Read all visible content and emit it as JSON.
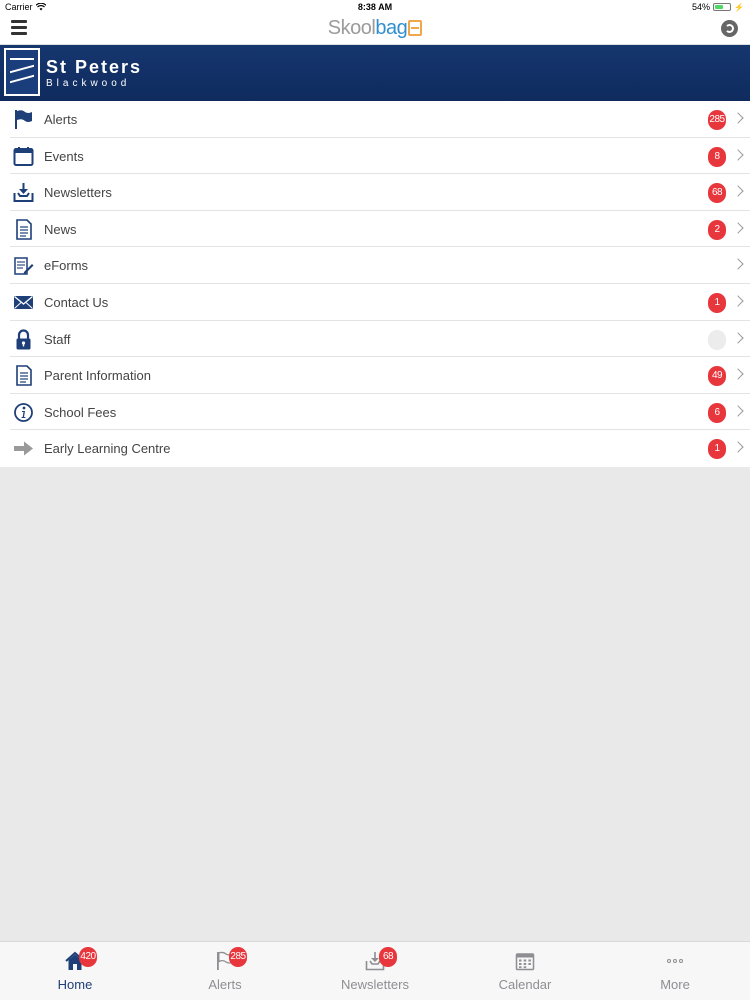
{
  "status_bar": {
    "carrier": "Carrier",
    "time": "8:38 AM",
    "battery": "54%",
    "battery_level": 0.54
  },
  "nav": {
    "logo_part1": "Skool",
    "logo_part2": "bag"
  },
  "school": {
    "name": "St Peters",
    "subtitle": "Blackwood"
  },
  "menu": [
    {
      "label": "Alerts",
      "badge": "285",
      "icon": "flag-icon"
    },
    {
      "label": "Events",
      "badge": "8",
      "icon": "calendar-icon"
    },
    {
      "label": "Newsletters",
      "badge": "68",
      "icon": "inbox-download-icon"
    },
    {
      "label": "News",
      "badge": "2",
      "icon": "document-icon"
    },
    {
      "label": "eForms",
      "badge": "",
      "icon": "form-pencil-icon"
    },
    {
      "label": "Contact Us",
      "badge": "1",
      "icon": "envelope-icon"
    },
    {
      "label": "Staff",
      "badge": "",
      "icon": "lock-icon"
    },
    {
      "label": "Parent Information",
      "badge": "49",
      "icon": "document-icon"
    },
    {
      "label": "School Fees",
      "badge": "6",
      "icon": "info-icon"
    },
    {
      "label": "Early Learning Centre",
      "badge": "1",
      "icon": "arrow-right-icon"
    }
  ],
  "tabs": [
    {
      "label": "Home",
      "badge": "420",
      "icon": "home-icon",
      "active": true
    },
    {
      "label": "Alerts",
      "badge": "285",
      "icon": "flag-icon"
    },
    {
      "label": "Newsletters",
      "badge": "68",
      "icon": "inbox-download-icon"
    },
    {
      "label": "Calendar",
      "badge": "",
      "icon": "calendar-icon"
    },
    {
      "label": "More",
      "badge": "",
      "icon": "more-dots-icon"
    }
  ],
  "colors": {
    "brand_navy": "#16366f",
    "badge_red": "#e8363d",
    "icon_blue": "#1e3f78"
  }
}
